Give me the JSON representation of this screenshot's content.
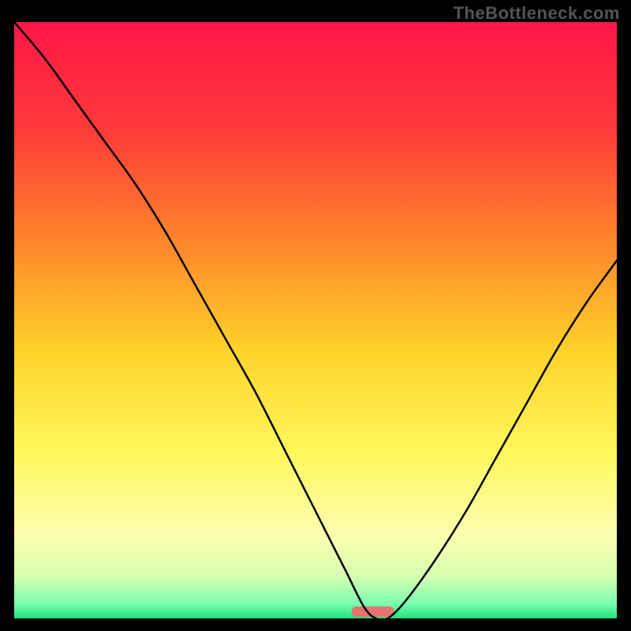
{
  "watermark": "TheBottleneck.com",
  "chart_data": {
    "type": "line",
    "title": "",
    "xlabel": "",
    "ylabel": "",
    "xlim": [
      0,
      100
    ],
    "ylim": [
      0,
      100
    ],
    "x": [
      0,
      5,
      10,
      15,
      20,
      25,
      30,
      35,
      40,
      45,
      50,
      55,
      58,
      60,
      62,
      65,
      70,
      75,
      80,
      85,
      90,
      95,
      100
    ],
    "values": [
      100,
      94,
      87,
      80,
      73,
      65,
      56,
      47,
      38,
      28,
      18,
      8,
      2,
      0,
      0,
      3,
      10,
      18,
      27,
      36,
      45,
      53,
      60
    ],
    "gradient_stops": [
      {
        "offset": 0.0,
        "color": "#ff1648"
      },
      {
        "offset": 0.18,
        "color": "#ff3a3a"
      },
      {
        "offset": 0.38,
        "color": "#ff8a2a"
      },
      {
        "offset": 0.55,
        "color": "#ffd22a"
      },
      {
        "offset": 0.72,
        "color": "#fff75a"
      },
      {
        "offset": 0.86,
        "color": "#fdffb0"
      },
      {
        "offset": 0.93,
        "color": "#d4ffb0"
      },
      {
        "offset": 0.975,
        "color": "#7dffb0"
      },
      {
        "offset": 1.0,
        "color": "#21e27e"
      }
    ],
    "marker": {
      "x_start": 56,
      "x_end": 63,
      "color": "#e6736e"
    },
    "line_color": "#000000",
    "line_width": 2.5
  }
}
